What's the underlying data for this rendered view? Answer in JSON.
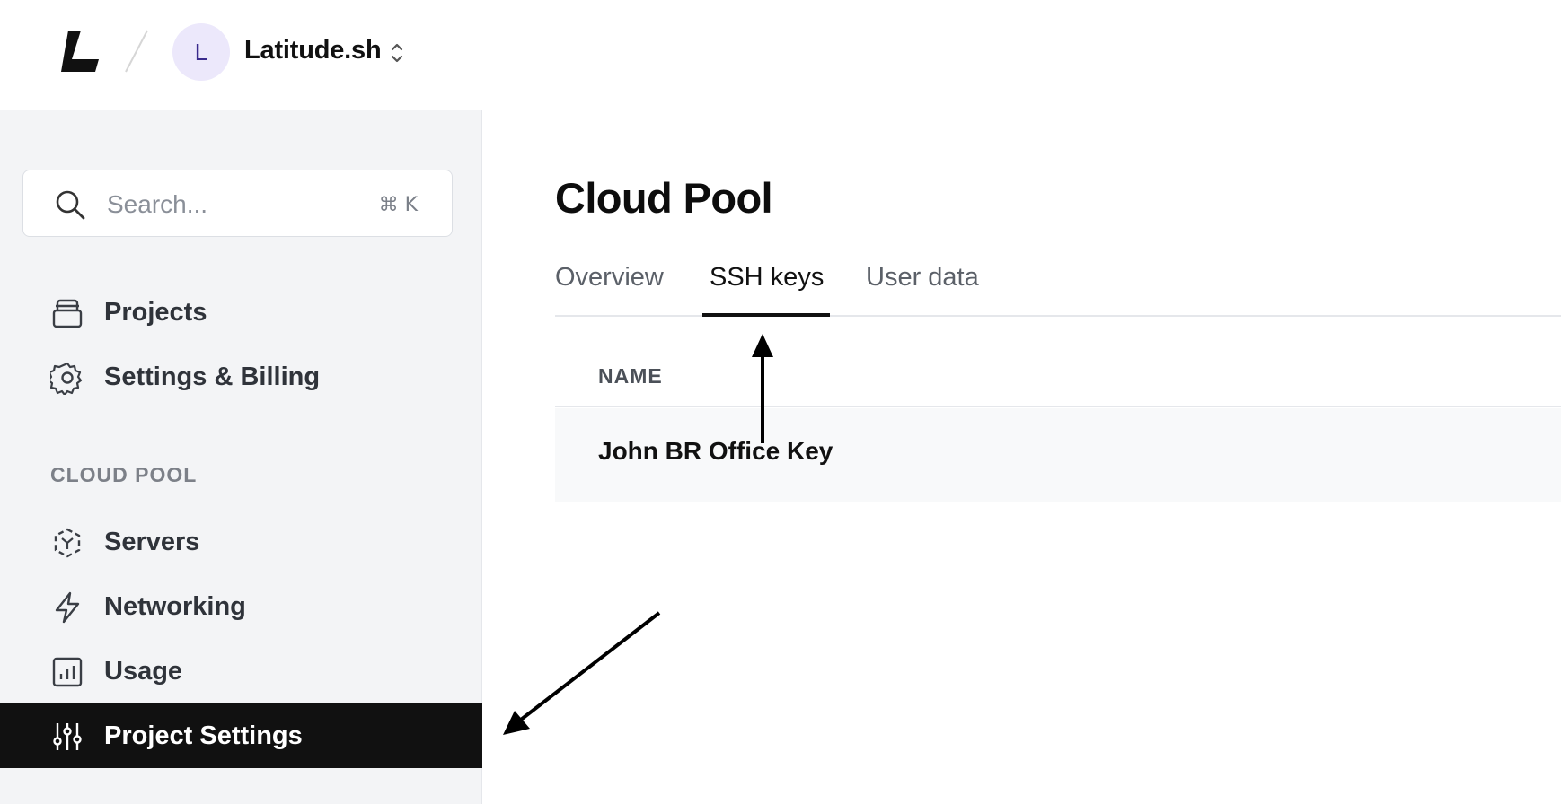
{
  "header": {
    "org_initial": "L",
    "org_name": "Latitude.sh"
  },
  "sidebar": {
    "search": {
      "placeholder": "Search...",
      "shortcut": "⌘ K"
    },
    "items": [
      {
        "label": "Projects",
        "icon": "folder-stack-icon"
      },
      {
        "label": "Settings & Billing",
        "icon": "gear-icon"
      }
    ],
    "section_label": "CLOUD POOL",
    "project_items": [
      {
        "label": "Servers",
        "icon": "server-icon"
      },
      {
        "label": "Networking",
        "icon": "lightning-icon"
      },
      {
        "label": "Usage",
        "icon": "bar-chart-icon"
      },
      {
        "label": "Project Settings",
        "icon": "sliders-icon",
        "active": true
      }
    ]
  },
  "main": {
    "title": "Cloud Pool",
    "tabs": [
      {
        "label": "Overview"
      },
      {
        "label": "SSH keys",
        "active": true
      },
      {
        "label": "User data"
      }
    ],
    "table": {
      "columns": [
        "NAME"
      ],
      "rows": [
        [
          "John BR Office Key"
        ]
      ]
    }
  },
  "colors": {
    "active_bg": "#111111",
    "sidebar_bg": "#f3f4f6",
    "avatar_bg": "#ece8fb"
  }
}
